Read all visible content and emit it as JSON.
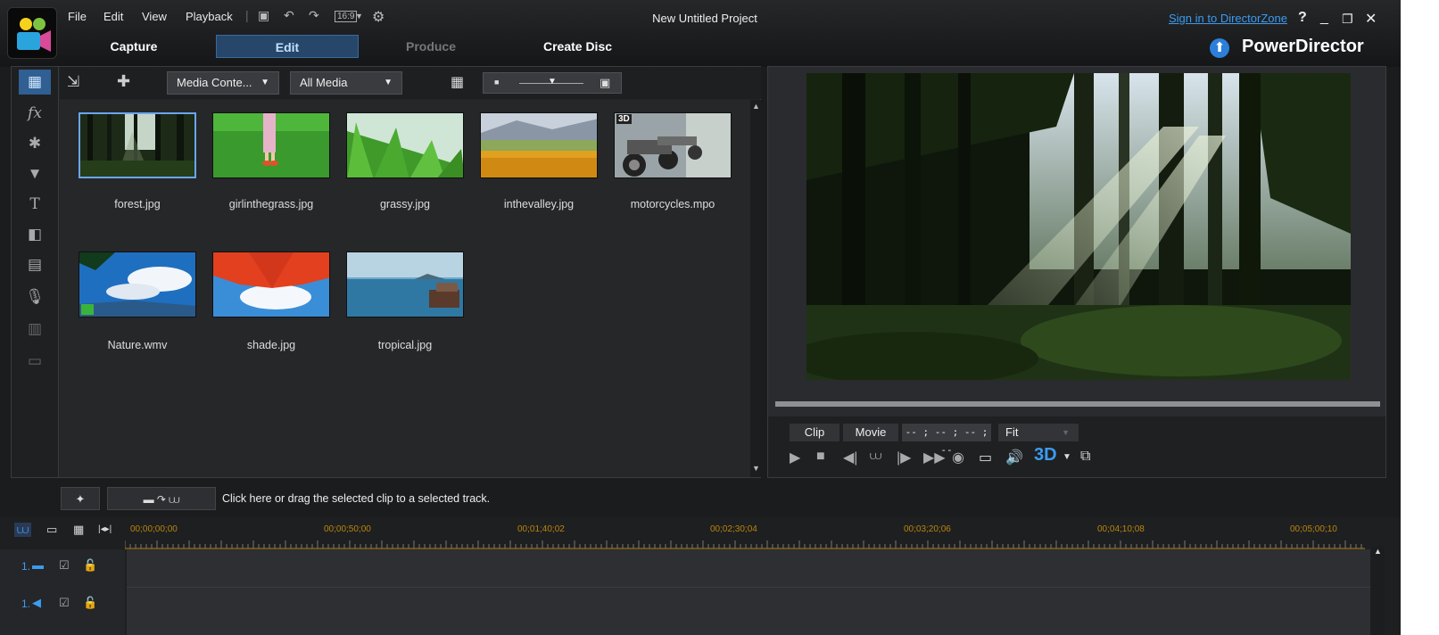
{
  "menu": {
    "file": "File",
    "edit": "Edit",
    "view": "View",
    "playback": "Playback"
  },
  "aspect_ratio": "16:9",
  "project_title": "New Untitled Project",
  "sign_in": "Sign in to DirectorZone",
  "main_tabs": {
    "capture": "Capture",
    "edit": "Edit",
    "produce": "Produce",
    "create_disc": "Create Disc"
  },
  "brand": "PowerDirector",
  "library": {
    "content_dropdown": "Media Conte...",
    "filter_dropdown": "All Media",
    "media": [
      {
        "name": "forest.jpg",
        "selected": true
      },
      {
        "name": "girlinthegrass.jpg"
      },
      {
        "name": "grassy.jpg"
      },
      {
        "name": "inthevalley.jpg"
      },
      {
        "name": "motorcycles.mpo",
        "badge": "3D"
      },
      {
        "name": "Nature.wmv"
      },
      {
        "name": "shade.jpg"
      },
      {
        "name": "tropical.jpg"
      }
    ]
  },
  "preview": {
    "clip_btn": "Clip",
    "movie_btn": "Movie",
    "timecode": "-- ; -- ; -- ; --",
    "fit": "Fit",
    "mode_3d": "3D"
  },
  "hint": "Click here or drag the selected clip to a selected track.",
  "ruler": [
    "00;00;00;00",
    "00;00;50;00",
    "00;01;40;02",
    "00;02;30;04",
    "00;03;20;06",
    "00;04;10;08",
    "00;05;00;10"
  ],
  "tracks": [
    {
      "label": "1."
    },
    {
      "label": "1."
    }
  ],
  "colors": {
    "accent": "#3b9cf0",
    "selection": "#6aa6ee",
    "ruler_text": "#b8860b"
  }
}
